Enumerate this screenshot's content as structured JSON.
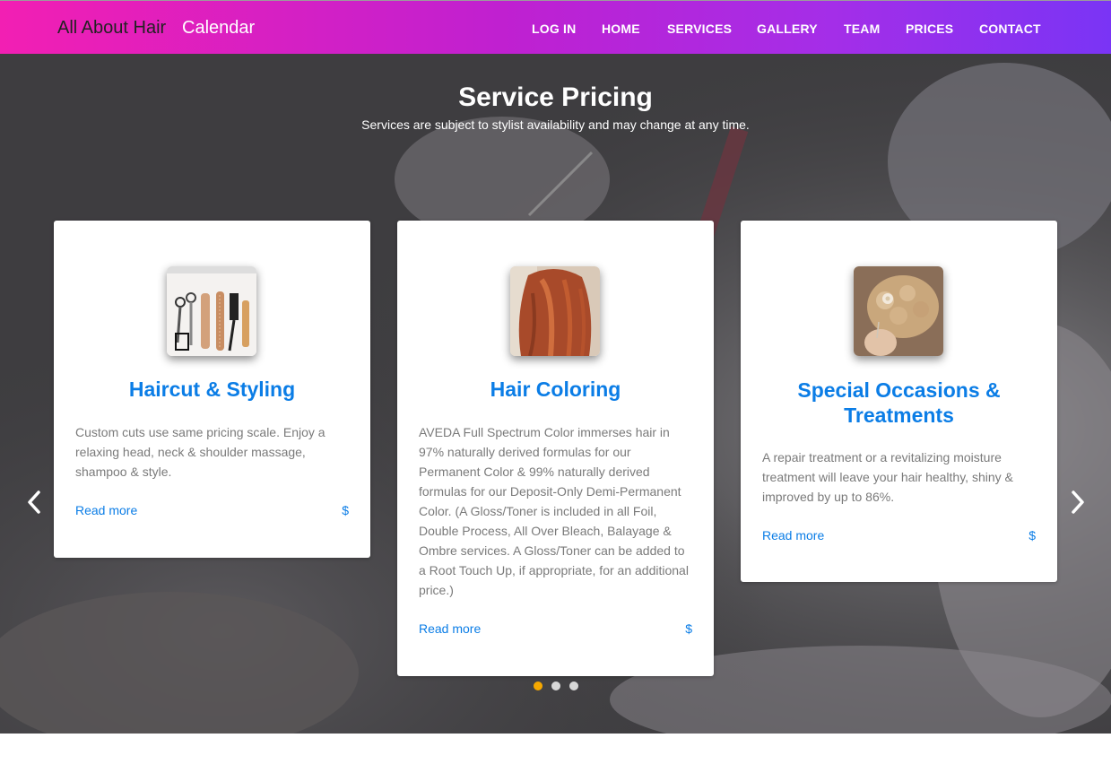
{
  "header": {
    "brand": "All About Hair",
    "calendar": "Calendar",
    "nav": [
      "LOG IN",
      "HOME",
      "SERVICES",
      "GALLERY",
      "TEAM",
      "PRICES",
      "CONTACT"
    ]
  },
  "hero": {
    "title": "Service Pricing",
    "subtitle": "Services are subject to stylist availability and may change at any time."
  },
  "cards": [
    {
      "title": "Haircut & Styling",
      "text": "Custom cuts use same pricing scale. Enjoy a relaxing head, neck & shoulder massage, shampoo & style.",
      "read_more": "Read more",
      "price": "$",
      "image_icon": "hair-tools-image"
    },
    {
      "title": "Hair Coloring",
      "text": "AVEDA Full Spectrum Color immerses hair in 97% naturally derived formulas for our Permanent Color & 99% naturally derived formulas for our Deposit-Only Demi-Permanent Color. (A Gloss/Toner is included in all Foil, Double Process, All Over Bleach, Balayage & Ombre services. A Gloss/Toner can be added to a Root Touch Up, if appropriate, for an additional price.)",
      "read_more": "Read more",
      "price": "$",
      "image_icon": "red-hair-image"
    },
    {
      "title": "Special Occasions & Treatments",
      "text": "A repair treatment or a revitalizing moisture treatment will leave your hair healthy, shiny & improved by up to 86%.",
      "read_more": "Read more",
      "price": "$",
      "image_icon": "updo-hairstyle-image"
    }
  ],
  "carousel": {
    "prev_icon": "chevron-left-icon",
    "next_icon": "chevron-right-icon",
    "active_dot": 0,
    "dot_count": 3
  },
  "colors": {
    "accent": "#0b7de6",
    "gradient_start": "#f21fb3",
    "gradient_end": "#7a34f5",
    "dot_active": "#f5a800",
    "dot_inactive": "#d8d8d8"
  }
}
